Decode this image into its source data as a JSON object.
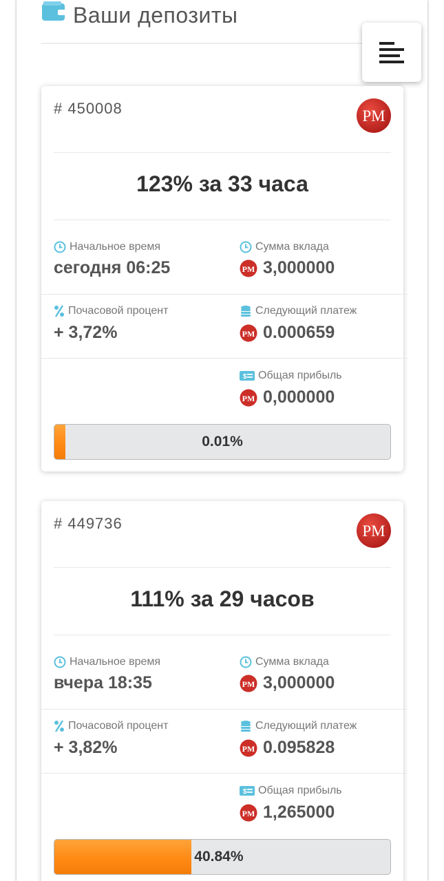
{
  "page_title": "Ваши депозиты",
  "labels": {
    "start_time": "Начальное время",
    "deposit_amount": "Сумма вклада",
    "hourly_percent": "Почасовой процент",
    "next_payment": "Следующий платеж",
    "total_profit": "Общая прибыль"
  },
  "currency_logo_text": "PM",
  "colors": {
    "accent_orange": "#ff8a14",
    "icon_blue": "#5bc0de",
    "pm_red": "#d0312d"
  },
  "deposits": [
    {
      "id": "# 450008",
      "rate": "123% за 33 часа",
      "start_time": "сегодня 06:25",
      "amount": "3,000000",
      "hourly_percent": "+ 3,72%",
      "next_payment": "0.000659",
      "total_profit": "0,000000",
      "progress_value": 0.0001,
      "progress_text": "0.01%"
    },
    {
      "id": "# 449736",
      "rate": "111% за 29 часов",
      "start_time": "вчера 18:35",
      "amount": "3,000000",
      "hourly_percent": "+ 3,82%",
      "next_payment": "0.095828",
      "total_profit": "1,265000",
      "progress_value": 0.4084,
      "progress_text": "40.84%"
    }
  ]
}
